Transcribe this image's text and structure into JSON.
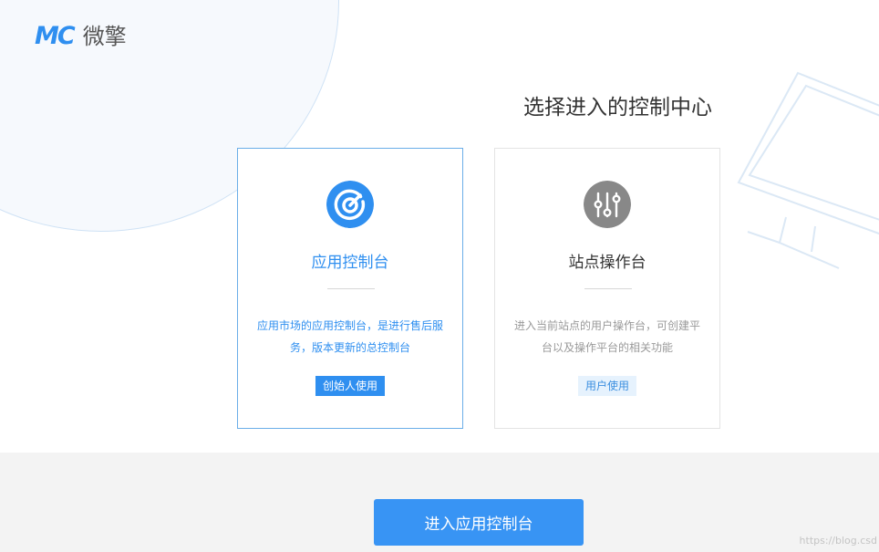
{
  "brand": {
    "mark": "MC",
    "name": "微擎"
  },
  "heading": "选择进入的控制中心",
  "cards": [
    {
      "title": "应用控制台",
      "description": "应用市场的应用控制台，是进行售后服务，版本更新的总控制台",
      "badge": "创始人使用",
      "icon": "speedometer-icon",
      "selected": true
    },
    {
      "title": "站点操作台",
      "description": "进入当前站点的用户操作台，可创建平台以及操作平台的相关功能",
      "badge": "用户使用",
      "icon": "sliders-icon",
      "selected": false
    }
  ],
  "footer": {
    "enter_button": "进入应用控制台"
  },
  "watermark": "https://blog.csd",
  "colors": {
    "accent": "#2f8ff0",
    "icon_gray": "#888888",
    "footer_bg": "#f3f3f3"
  }
}
